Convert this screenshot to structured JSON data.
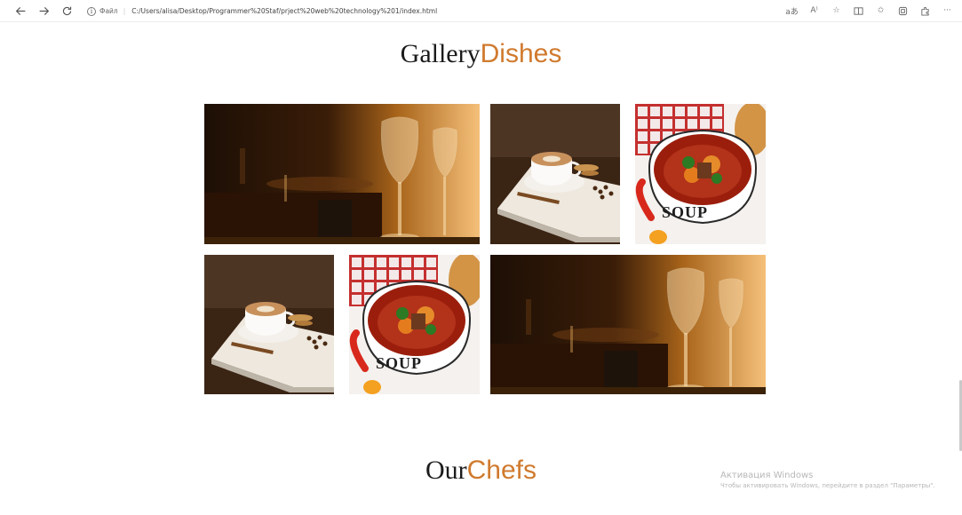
{
  "browser": {
    "back_icon": "arrow-left-icon",
    "forward_icon": "arrow-right-icon",
    "refresh_icon": "refresh-icon",
    "site_info_icon": "info-icon",
    "scheme_label": "Файл",
    "address": "C:/Users/alisa/Desktop/Programmer%20Staf/prject%20web%20technology%201/index.html",
    "right_icons": [
      "read-aloud-icon",
      "text-size-icon",
      "favorite-star-icon",
      "split-screen-icon",
      "favorites-icon",
      "collections-icon",
      "extensions-icon",
      "more-menu-icon"
    ]
  },
  "gallery_heading": {
    "word1": "Gallery",
    "word2": "Dishes"
  },
  "gallery": {
    "images": [
      {
        "subject": "restaurant-wine-glasses"
      },
      {
        "subject": "cappuccino-cookies"
      },
      {
        "subject": "soup-bowl"
      },
      {
        "subject": "cappuccino-cookies"
      },
      {
        "subject": "soup-bowl"
      },
      {
        "subject": "restaurant-wine-glasses"
      }
    ]
  },
  "chefs_heading": {
    "word1": "Our",
    "word2": "Chefs"
  },
  "watermark": {
    "line1": "Активация Windows",
    "line2": "Чтобы активировать Windows, перейдите в раздел \"Параметры\"."
  },
  "colors": {
    "accent": "#d07a2e",
    "heading_text": "#1b1b1b"
  }
}
